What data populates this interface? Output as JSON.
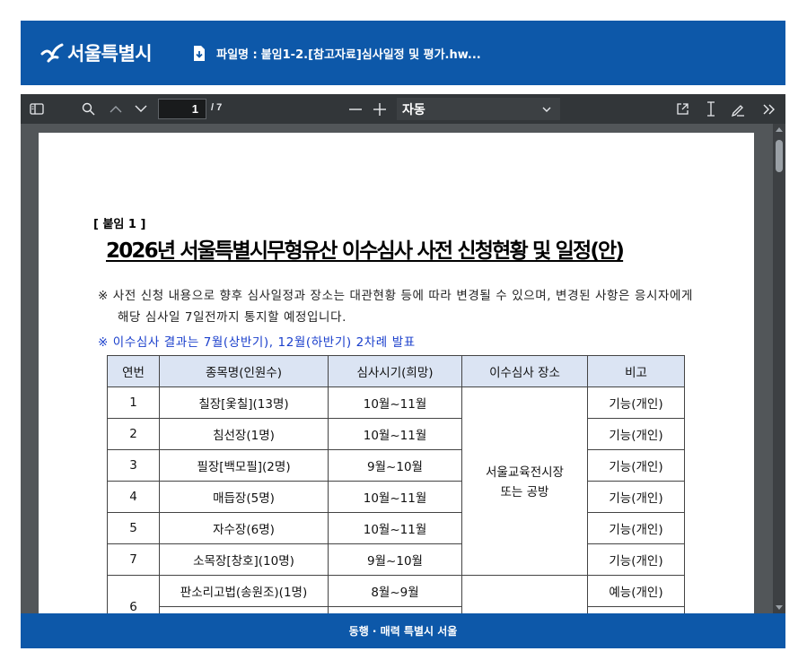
{
  "header": {
    "logo_text": "서울특별시",
    "file_label": "파일명 :",
    "file_name": "붙임1-2.[참고자료]심사일정 및 평가.hw..."
  },
  "toolbar": {
    "current_page": "1",
    "total_pages": "/ 7",
    "zoom": "자동",
    "icons": [
      "sidebar-toggle-icon",
      "search-icon",
      "chevron-up-icon",
      "chevron-down-icon",
      "zoom-out-icon",
      "zoom-in-icon",
      "open-external-icon",
      "text-cursor-icon",
      "draw-icon",
      "more-tools-icon"
    ]
  },
  "document": {
    "attach_label": "[ 붙임 1 ]",
    "title": "2026년 서울특별시무형유산 이수심사 사전 신청현황 및 일정(안)",
    "note": "※ 사전 신청 내용으로 향후 심사일정과 장소는 대관현황 등에 따라 변경될 수 있으며, 변경된 사항은 응시자에게 해당 심사일 7일전까지 통지할 예정입니다.",
    "note_highlight": "※ 이수심사 결과는 7월(상반기), 12월(하반기) 2차례 발표",
    "table": {
      "headers": [
        "연번",
        "종목명(인원수)",
        "심사시기(희망)",
        "이수심사 장소",
        "비고"
      ],
      "venue": "서울교육전시장\n또는 공방",
      "rows": [
        {
          "no": "1",
          "name": "칠장[옻칠](13명)",
          "period": "10월~11월",
          "remark": "기능(개인)"
        },
        {
          "no": "2",
          "name": "침선장(1명)",
          "period": "10월~11월",
          "remark": "기능(개인)"
        },
        {
          "no": "3",
          "name": "필장[백모필](2명)",
          "period": "9월~10월",
          "remark": "기능(개인)"
        },
        {
          "no": "4",
          "name": "매듭장(5명)",
          "period": "10월~11월",
          "remark": "기능(개인)"
        },
        {
          "no": "5",
          "name": "자수장(6명)",
          "period": "10월~11월",
          "remark": "기능(개인)"
        },
        {
          "no": "7",
          "name": "소목장[창호](10명)",
          "period": "9월~10월",
          "remark": "기능(개인)"
        }
      ],
      "last_row": {
        "no": "6",
        "name": "판소리고법(송원조)(1명)",
        "period": "8월~9월",
        "remark": "예능(개인)"
      }
    }
  },
  "footer": {
    "slogan": "동행 · 매력 특별시 서울"
  },
  "colors": {
    "brand_blue": "#0d58a9",
    "toolbar_bg": "#323639",
    "viewer_bg": "#525659",
    "table_header_bg": "#dbe4f3",
    "highlight_blue": "#1a3fcc"
  }
}
